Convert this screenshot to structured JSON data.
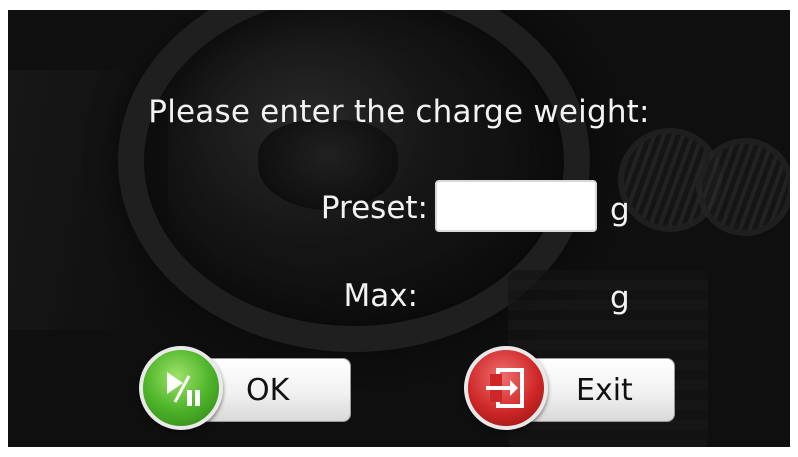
{
  "dialog": {
    "prompt": "Please enter the charge weight:",
    "preset_label": "Preset:",
    "preset_value": "",
    "preset_unit": "g",
    "max_label": "Max:",
    "max_value": "",
    "max_unit": "g"
  },
  "buttons": {
    "ok_label": "OK",
    "ok_icon": "play-pause-icon",
    "exit_label": "Exit",
    "exit_icon": "exit-door-icon"
  },
  "colors": {
    "ok_accent": "#4fb52a",
    "exit_accent": "#cf2727",
    "text": "#f2f2f2"
  }
}
